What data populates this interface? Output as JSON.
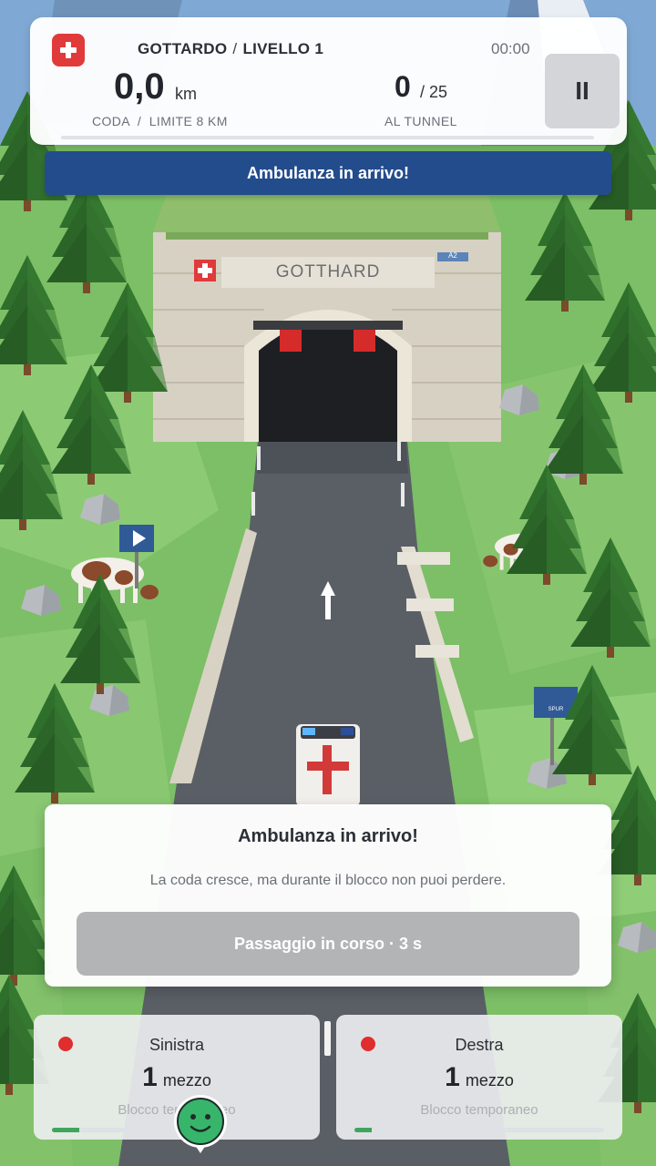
{
  "hud": {
    "route": "GOTTARDO",
    "separator": "/",
    "level": "LIVELLO 1",
    "timer": "00:00",
    "queue_value": "0,0",
    "queue_unit": "km",
    "queue_label": "CODA  /  LIMITE 8 KM",
    "tunnel_value": "0",
    "tunnel_total": "/ 25",
    "tunnel_label": "AL TUNNEL",
    "progress_fraction": 0,
    "pause_label": "II"
  },
  "banner": {
    "text": "Ambulanza in arrivo!"
  },
  "scene": {
    "tunnel_sign": "GOTTHARD",
    "road_sign_small": "A2",
    "side_sign": "SPUR"
  },
  "dialog": {
    "title": "Ambulanza in arrivo!",
    "body": "La coda cresce, ma durante il blocco non puoi perdere.",
    "action_label": "Passaggio in corso · 3 s"
  },
  "lanes": [
    {
      "name": "Sinistra",
      "count": "1",
      "unit": "mezzo",
      "status": "Blocco temporaneo",
      "progress_fraction": 0.11
    },
    {
      "name": "Destra",
      "count": "1",
      "unit": "mezzo",
      "status": "Blocco temporaneo",
      "progress_fraction": 0.07
    }
  ],
  "colors": {
    "accent_red": "#e03a3a",
    "banner_blue": "#234c8d",
    "progress_green": "#3fa55e",
    "grass": "#7cbf66",
    "road": "#555a60"
  }
}
